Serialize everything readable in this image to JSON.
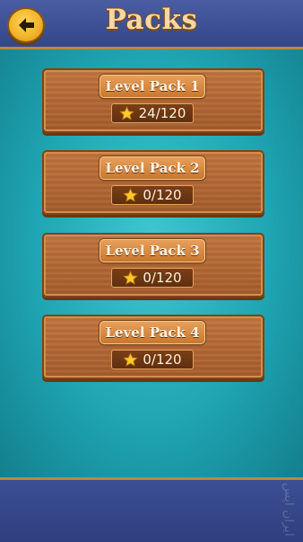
{
  "header": {
    "title": "Packs",
    "back_icon": "arrow-left-icon"
  },
  "packs": [
    {
      "label": "Level Pack 1",
      "progress": "24/120"
    },
    {
      "label": "Level Pack 2",
      "progress": "0/120"
    },
    {
      "label": "Level Pack 3",
      "progress": "0/120"
    },
    {
      "label": "Level Pack 4",
      "progress": "0/120"
    }
  ],
  "colors": {
    "background": "#1fa5b3",
    "bars": "#3a4a86",
    "wood": "#b66a35",
    "title_text": "#f7d7a3",
    "back_button": "#f3b52a"
  },
  "watermark": {
    "text": "ایران اپس"
  }
}
